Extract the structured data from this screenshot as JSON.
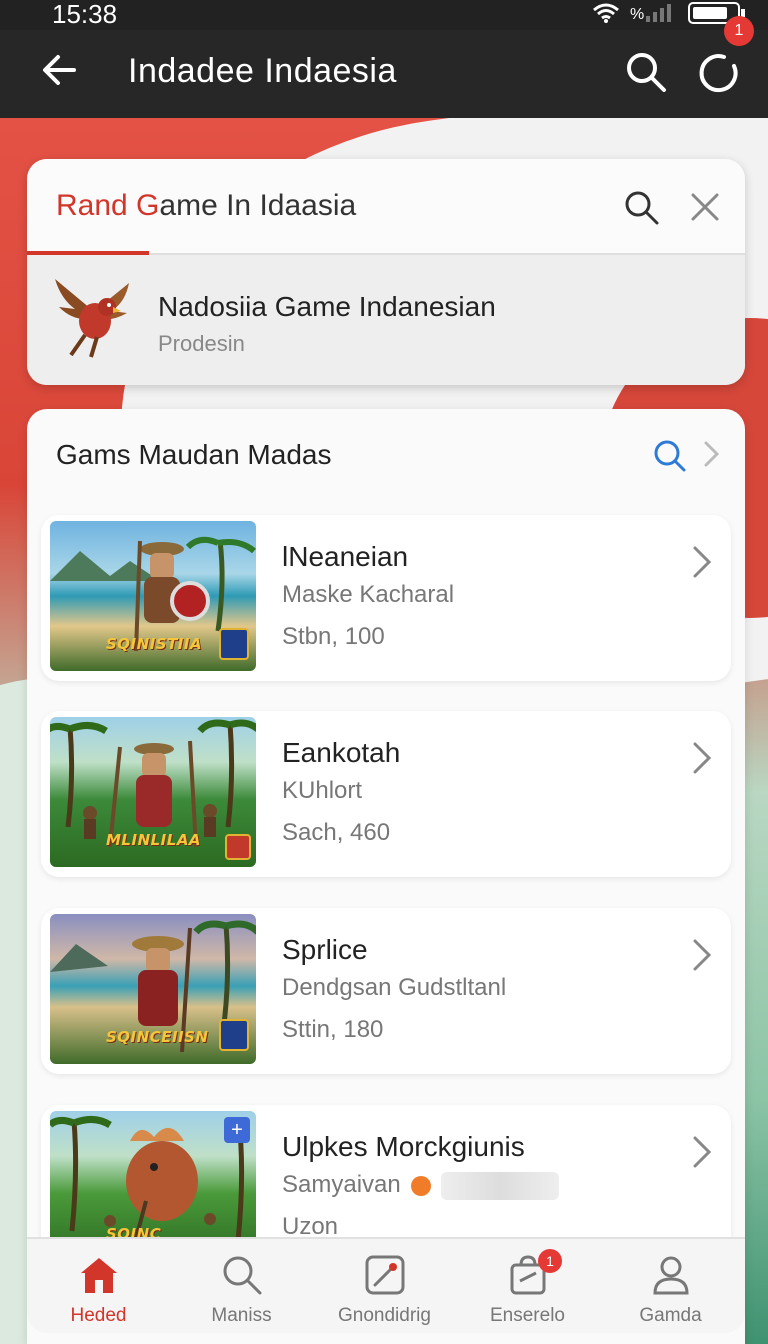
{
  "status_bar": {
    "time": "15:38",
    "battery_level": 0.8,
    "icons": [
      "wifi-icon",
      "signal-icon",
      "battery-icon"
    ]
  },
  "app_bar": {
    "title": "Indadee Indaesia",
    "notification_count": "1",
    "icons": [
      "back-arrow-icon",
      "search-icon",
      "notification-icon"
    ]
  },
  "search": {
    "query_highlight": "Rand G",
    "query_rest": "ame In Idaasia",
    "suggestion": {
      "title": "Nadosiia Game Indanesian",
      "subtitle": "Prodesin",
      "logo_icon": "eagle-logo-icon"
    }
  },
  "games_panel": {
    "title": "Gams Maudan Madas",
    "items": [
      {
        "name": "lNeaneian",
        "subtitle": "Maske Kacharal",
        "meta": "Stbn, 100",
        "thumb_text": "SQINISTIIA"
      },
      {
        "name": "Eankotah",
        "subtitle": "KUhlort",
        "meta": "Sach, 460",
        "thumb_text": "MLINLILAA"
      },
      {
        "name": "Sprlice",
        "subtitle": "Dendgsan Gudstltanl",
        "meta": "Sttin, 180",
        "thumb_text": "SQINCEIISN"
      },
      {
        "name": "Ulpkes Morckgiunis",
        "subtitle": "Samyaivan",
        "meta": "Uzon",
        "thumb_text": "SQINC"
      }
    ]
  },
  "bottom_nav": {
    "items": [
      {
        "label": "Heded",
        "icon": "home-icon",
        "active": true
      },
      {
        "label": "Maniss",
        "icon": "search-icon"
      },
      {
        "label": "Gnondidrig",
        "icon": "edit-icon"
      },
      {
        "label": "Enserelo",
        "icon": "bag-icon",
        "badge": "1"
      },
      {
        "label": "Gamda",
        "icon": "profile-icon"
      }
    ]
  },
  "colors": {
    "accent": "#d2352a",
    "app_bar": "#272727",
    "link_blue": "#2d7bd6"
  }
}
